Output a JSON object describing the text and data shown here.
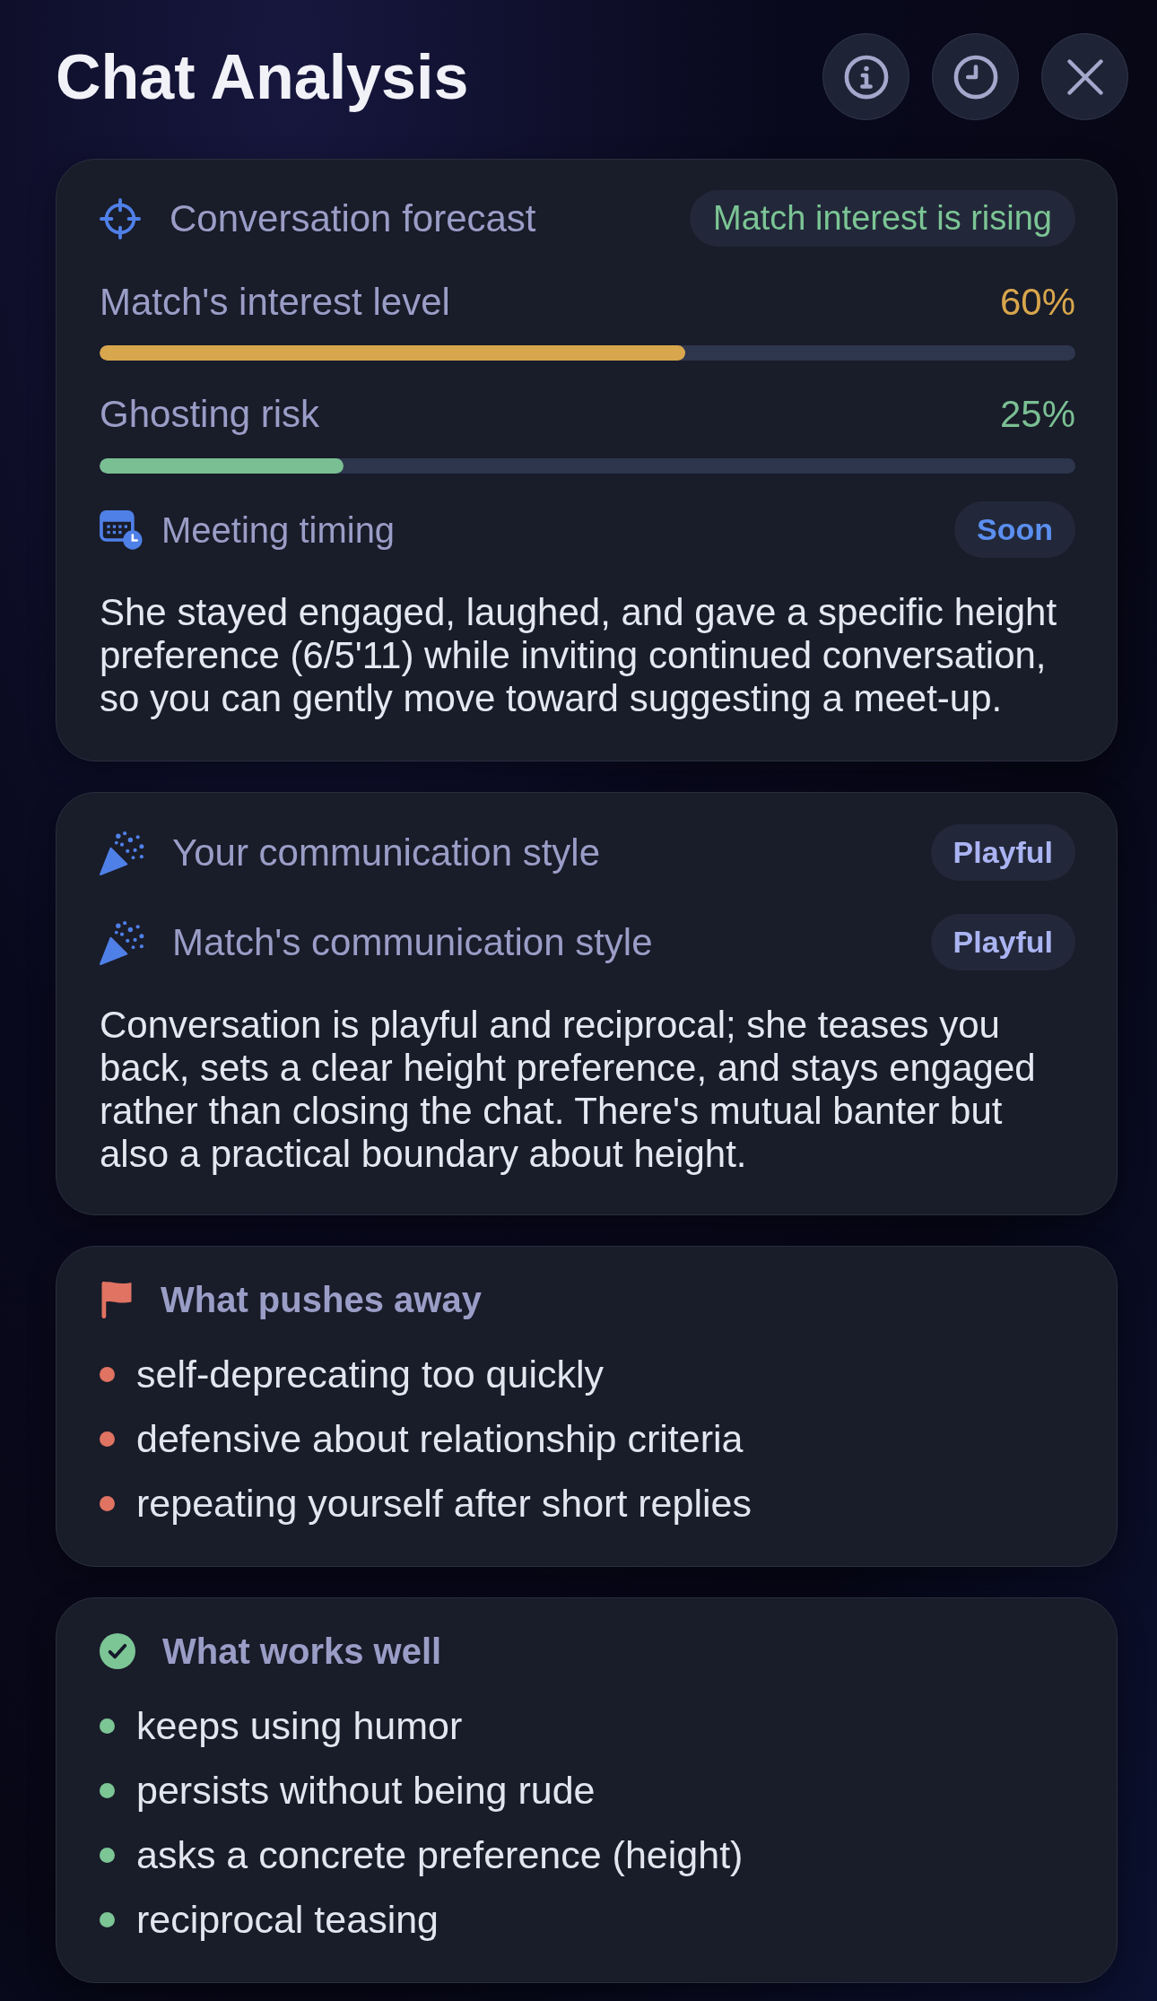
{
  "header": {
    "title": "Chat Analysis"
  },
  "forecast": {
    "title": "Conversation forecast",
    "badge": "Match interest is rising",
    "meters": [
      {
        "label": "Match's interest level",
        "reading": "60%",
        "level": 0.6,
        "color": "#d8a64c"
      },
      {
        "label": "Ghosting risk",
        "reading": "25%",
        "level": 0.25,
        "color": "#7abf93"
      }
    ],
    "meeting": {
      "label": "Meeting timing",
      "value": "Soon"
    },
    "summary": "She stayed engaged, laughed, and gave a specific height preference (6/5'11) while inviting continued conversation, so you can gently move toward suggesting a meet-up."
  },
  "styles": {
    "rows": [
      {
        "label": "Your communication style",
        "value": "Playful"
      },
      {
        "label": "Match's communication style",
        "value": "Playful"
      }
    ],
    "summary": "Conversation is playful and reciprocal; she teases you back, sets a clear height preference, and stays engaged rather than closing the chat. There's mutual banter but also a practical boundary about height."
  },
  "sections": [
    {
      "kind": "negative",
      "title": "What pushes away",
      "items": [
        "self-deprecating too quickly",
        "defensive about relationship criteria",
        "repeating yourself after short replies"
      ]
    },
    {
      "kind": "positive",
      "title": "What works well",
      "items": [
        "keeps using humor",
        "persists without being rude",
        "asks a concrete preference (height)",
        "reciprocal teasing"
      ]
    }
  ]
}
